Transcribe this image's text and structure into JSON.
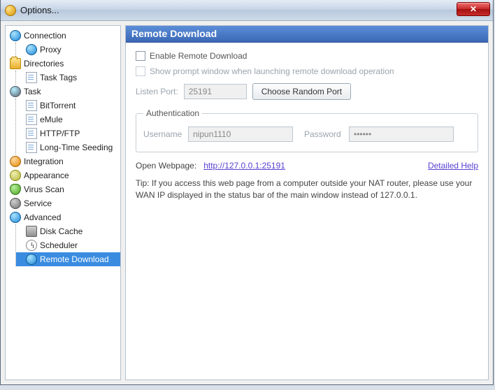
{
  "window": {
    "title": "Options..."
  },
  "sidebar": {
    "items": [
      {
        "label": "Connection"
      },
      {
        "label": "Proxy"
      },
      {
        "label": "Directories"
      },
      {
        "label": "Task Tags"
      },
      {
        "label": "Task"
      },
      {
        "label": "BitTorrent"
      },
      {
        "label": "eMule"
      },
      {
        "label": "HTTP/FTP"
      },
      {
        "label": "Long-Time Seeding"
      },
      {
        "label": "Integration"
      },
      {
        "label": "Appearance"
      },
      {
        "label": "Virus Scan"
      },
      {
        "label": "Service"
      },
      {
        "label": "Advanced"
      },
      {
        "label": "Disk Cache"
      },
      {
        "label": "Scheduler"
      },
      {
        "label": "Remote Download"
      }
    ]
  },
  "panel": {
    "title": "Remote Download",
    "enable_label": "Enable Remote Download",
    "prompt_label": "Show prompt window when launching remote download operation",
    "listen_port_label": "Listen Port:",
    "listen_port_value": "25191",
    "random_port_btn": "Choose Random Port",
    "auth_legend": "Authentication",
    "username_label": "Username",
    "username_value": "nipun1110",
    "password_label": "Password",
    "password_value": "••••••",
    "open_webpage_label": "Open Webpage:",
    "open_webpage_url": "http://127.0.0.1:25191",
    "detailed_help": "Detailed Help",
    "tip": "Tip: If you access this web page from a computer outside your NAT router, please use your WAN IP displayed in the status bar of the main window instead of 127.0.0.1."
  }
}
